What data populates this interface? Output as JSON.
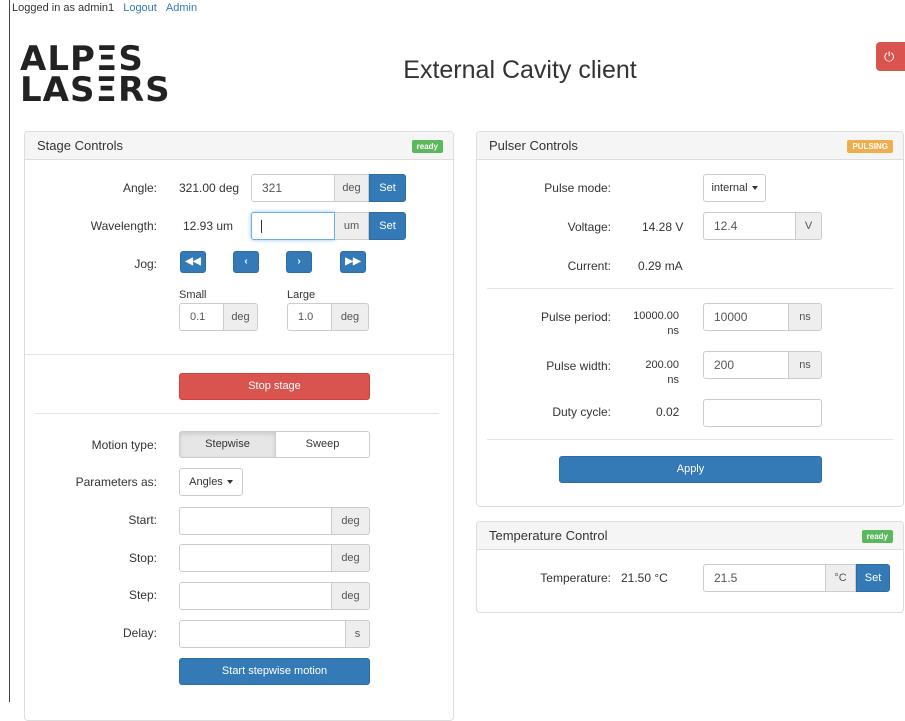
{
  "topbar": {
    "logged_in_text": "Logged in as admin1",
    "logout_link": "Logout",
    "admin_link": "Admin"
  },
  "logo": {
    "line1": "ALPΞS",
    "line2": "LASΞRS"
  },
  "header": {
    "title": "External Cavity client",
    "power_icon": "power-icon",
    "power_color": "#d9534f"
  },
  "stage": {
    "title": "Stage Controls",
    "status": "ready",
    "angle": {
      "label": "Angle:",
      "current": "321.00 deg",
      "input": "321",
      "unit": "deg",
      "set": "Set"
    },
    "wavelength": {
      "label": "Wavelength:",
      "current": "12.93 um",
      "input": "",
      "unit": "um",
      "set": "Set"
    },
    "jog": {
      "label": "Jog:",
      "buttons": [
        "fast-backward-icon",
        "chevron-left-icon",
        "chevron-right-icon",
        "fast-forward-icon"
      ],
      "small_label": "Small",
      "small_value": "0.1",
      "small_unit": "deg",
      "large_label": "Large",
      "large_value": "1.0",
      "large_unit": "deg"
    },
    "stop_button": "Stop stage",
    "motion": {
      "label": "Motion type:",
      "options": [
        "Stepwise",
        "Sweep"
      ],
      "selected": "Stepwise",
      "params_label": "Parameters as:",
      "params_value": "Angles",
      "start_label": "Start:",
      "start_unit": "deg",
      "stop_label": "Stop:",
      "stop_unit": "deg",
      "step_label": "Step:",
      "step_unit": "deg",
      "delay_label": "Delay:",
      "delay_unit": "s",
      "start_button": "Start stepwise motion"
    }
  },
  "pulser": {
    "title": "Pulser Controls",
    "status": "PULSING",
    "pulse_mode": {
      "label": "Pulse mode:",
      "value": "internal"
    },
    "voltage": {
      "label": "Voltage:",
      "current": "14.28 V",
      "input": "12.4",
      "unit": "V"
    },
    "current": {
      "label": "Current:",
      "value": "0.29 mA"
    },
    "period": {
      "label": "Pulse period:",
      "current_a": "10000.00",
      "current_b": "ns",
      "input": "10000",
      "unit": "ns"
    },
    "width": {
      "label": "Pulse width:",
      "current_a": "200.00",
      "current_b": "ns",
      "input": "200",
      "unit": "ns"
    },
    "duty": {
      "label": "Duty cycle:",
      "value": "0.02",
      "input": ""
    },
    "apply": "Apply"
  },
  "temperature": {
    "title": "Temperature Control",
    "status": "ready",
    "label": "Temperature:",
    "current": "21.50 °C",
    "input": "21.5",
    "unit": "°C",
    "set": "Set"
  },
  "colors": {
    "primary": "#337ab7",
    "danger": "#d9534f",
    "success": "#5cb85c",
    "warning": "#f0ad4e"
  }
}
